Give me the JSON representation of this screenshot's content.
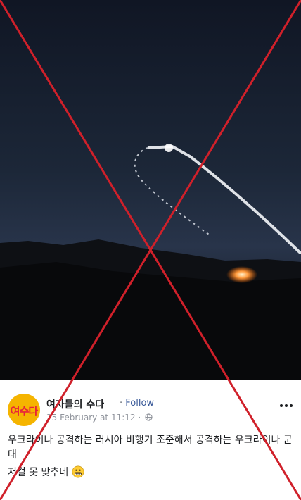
{
  "post": {
    "avatar_text": "여수다",
    "page_name": "여자들의 수다",
    "separator": "·",
    "follow_label": "Follow",
    "timestamp": "25 February at 11:12",
    "meta_separator": "·",
    "privacy_icon": "globe-icon",
    "more_icon": "more-options-icon",
    "text_line_1": "우크라이나 공격하는 러시아 비행기 조준해서 공격하는 우크라이나 군대",
    "text_line_2": "저걸 못 맞추네",
    "emoji_icon": "grimacing-face-icon"
  },
  "colors": {
    "overlay_cross": "#d0202a",
    "avatar_bg": "#f5b400",
    "avatar_text": "#e8213a",
    "link": "#385898",
    "night_sky": "#1b2432"
  }
}
